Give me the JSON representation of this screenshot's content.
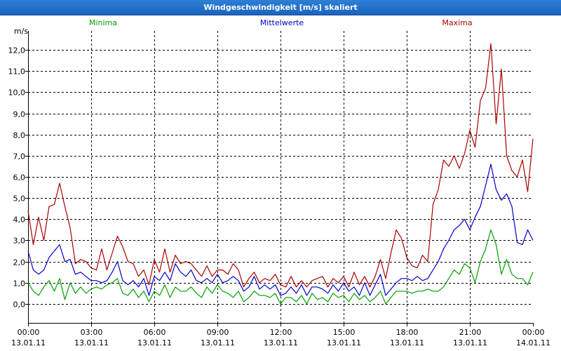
{
  "window": {
    "title": "Windgeschwindigkeit [m/s] skaliert"
  },
  "chart_data": {
    "type": "line",
    "title": "Windgeschwindigkeit [m/s] skaliert",
    "ylabel": "m/s",
    "ylim": [
      -0.9,
      12.9
    ],
    "yticks": [
      0,
      1,
      2,
      3,
      4,
      5,
      6,
      7,
      8,
      9,
      10,
      11,
      12
    ],
    "ytick_labels": [
      "0,0",
      "1,0",
      "2,0",
      "3,0",
      "4,0",
      "5,0",
      "6,0",
      "7,0",
      "8,0",
      "9,0",
      "10,0",
      "11,0",
      "12,0"
    ],
    "xlim": [
      0,
      24
    ],
    "xticks": [
      0,
      3,
      6,
      9,
      12,
      15,
      18,
      21,
      24
    ],
    "xtick_labels": [
      {
        "time": "00:00",
        "date": "13.01.11"
      },
      {
        "time": "03:00",
        "date": "13.01.11"
      },
      {
        "time": "06:00",
        "date": "13.01.11"
      },
      {
        "time": "09:00",
        "date": "13.01.11"
      },
      {
        "time": "12:00",
        "date": "13.01.11"
      },
      {
        "time": "15:00",
        "date": "13.01.11"
      },
      {
        "time": "18:00",
        "date": "13.01.11"
      },
      {
        "time": "21:00",
        "date": "13.01.11"
      },
      {
        "time": "00:00",
        "date": "14.01.11"
      }
    ],
    "grid": true,
    "legend_position": "top",
    "series": [
      {
        "name": "Minima",
        "color": "#00a000",
        "x": [
          0,
          0.25,
          0.5,
          0.75,
          1.0,
          1.25,
          1.5,
          1.75,
          2.0,
          2.25,
          2.5,
          2.75,
          3.0,
          3.25,
          3.5,
          3.75,
          4.0,
          4.25,
          4.5,
          4.75,
          5.0,
          5.25,
          5.5,
          5.75,
          6.0,
          6.25,
          6.5,
          6.75,
          7.0,
          7.25,
          7.5,
          7.75,
          8.0,
          8.25,
          8.5,
          8.75,
          9.0,
          9.25,
          9.5,
          9.75,
          10.0,
          10.25,
          10.5,
          10.75,
          11.0,
          11.25,
          11.5,
          11.75,
          12.0,
          12.25,
          12.5,
          12.75,
          13.0,
          13.25,
          13.5,
          13.75,
          14.0,
          14.25,
          14.5,
          14.75,
          15.0,
          15.25,
          15.5,
          15.75,
          16.0,
          16.25,
          16.5,
          16.75,
          17.0,
          17.25,
          17.5,
          17.75,
          18.0,
          18.25,
          18.5,
          18.75,
          19.0,
          19.25,
          19.5,
          19.75,
          20.0,
          20.25,
          20.5,
          20.75,
          21.0,
          21.25,
          21.5,
          21.75,
          22.0,
          22.25,
          22.5,
          22.75,
          23.0,
          23.25,
          23.5,
          23.75,
          24.0
        ],
        "y": [
          1.0,
          0.6,
          0.4,
          0.8,
          1.1,
          0.6,
          1.2,
          0.2,
          1.0,
          0.5,
          0.8,
          0.5,
          0.7,
          0.8,
          0.7,
          0.9,
          1.0,
          1.2,
          0.5,
          0.4,
          0.7,
          0.3,
          0.6,
          0.1,
          0.6,
          0.4,
          0.9,
          0.3,
          0.8,
          0.6,
          0.6,
          0.8,
          0.5,
          0.3,
          0.8,
          0.5,
          0.9,
          0.6,
          0.5,
          0.3,
          0.6,
          0.1,
          0.3,
          0.6,
          0.4,
          0.4,
          0.3,
          0.5,
          0.0,
          0.3,
          0.3,
          0.1,
          0.4,
          0.0,
          0.5,
          0.2,
          0.3,
          0.1,
          0.5,
          0.3,
          0.4,
          0.1,
          0.5,
          0.2,
          0.4,
          0.1,
          0.3,
          0.6,
          0.0,
          0.3,
          0.6,
          0.6,
          0.6,
          0.5,
          0.6,
          0.6,
          0.7,
          0.6,
          0.6,
          0.8,
          1.2,
          1.6,
          1.4,
          1.9,
          1.7,
          1.0,
          2.0,
          2.6,
          3.5,
          2.8,
          1.4,
          2.1,
          1.4,
          1.2,
          1.2,
          0.9,
          1.5
        ]
      },
      {
        "name": "Mittelwerte",
        "color": "#0000cc",
        "x": [
          0,
          0.25,
          0.5,
          0.75,
          1.0,
          1.25,
          1.5,
          1.75,
          2.0,
          2.25,
          2.5,
          2.75,
          3.0,
          3.25,
          3.5,
          3.75,
          4.0,
          4.25,
          4.5,
          4.75,
          5.0,
          5.25,
          5.5,
          5.75,
          6.0,
          6.25,
          6.5,
          6.75,
          7.0,
          7.25,
          7.5,
          7.75,
          8.0,
          8.25,
          8.5,
          8.75,
          9.0,
          9.25,
          9.5,
          9.75,
          10.0,
          10.25,
          10.5,
          10.75,
          11.0,
          11.25,
          11.5,
          11.75,
          12.0,
          12.25,
          12.5,
          12.75,
          13.0,
          13.25,
          13.5,
          13.75,
          14.0,
          14.25,
          14.5,
          14.75,
          15.0,
          15.25,
          15.5,
          15.75,
          16.0,
          16.25,
          16.5,
          16.75,
          17.0,
          17.25,
          17.5,
          17.75,
          18.0,
          18.25,
          18.5,
          18.75,
          19.0,
          19.25,
          19.5,
          19.75,
          20.0,
          20.25,
          20.5,
          20.75,
          21.0,
          21.25,
          21.5,
          21.75,
          22.0,
          22.25,
          22.5,
          22.75,
          23.0,
          23.25,
          23.5,
          23.75,
          24.0
        ],
        "y": [
          2.5,
          1.6,
          1.4,
          1.6,
          2.2,
          2.5,
          2.8,
          2.0,
          2.1,
          1.4,
          1.5,
          1.3,
          1.1,
          1.1,
          1.0,
          1.1,
          1.5,
          2.0,
          1.1,
          0.9,
          1.1,
          0.8,
          1.2,
          0.4,
          1.3,
          1.1,
          1.5,
          1.1,
          1.9,
          1.5,
          1.3,
          1.6,
          1.1,
          1.0,
          1.2,
          1.0,
          1.4,
          1.0,
          1.1,
          1.3,
          1.1,
          0.6,
          0.8,
          1.3,
          0.7,
          0.9,
          0.7,
          0.9,
          0.4,
          0.5,
          0.8,
          0.5,
          0.9,
          0.4,
          0.8,
          0.8,
          0.7,
          0.5,
          0.9,
          0.6,
          1.0,
          0.6,
          0.8,
          0.4,
          1.0,
          0.4,
          0.9,
          1.4,
          0.4,
          0.7,
          1.0,
          1.2,
          1.2,
          1.1,
          1.3,
          1.1,
          1.2,
          1.6,
          2.0,
          2.6,
          3.0,
          3.5,
          3.7,
          4.0,
          3.5,
          4.1,
          4.6,
          5.6,
          6.6,
          5.4,
          4.9,
          5.2,
          4.6,
          2.9,
          2.8,
          3.5,
          3.0
        ]
      },
      {
        "name": "Maxima",
        "color": "#aa0000",
        "x": [
          0,
          0.25,
          0.5,
          0.75,
          1.0,
          1.25,
          1.5,
          1.75,
          2.0,
          2.25,
          2.5,
          2.75,
          3.0,
          3.25,
          3.5,
          3.75,
          4.0,
          4.25,
          4.5,
          4.75,
          5.0,
          5.25,
          5.5,
          5.75,
          6.0,
          6.25,
          6.5,
          6.75,
          7.0,
          7.25,
          7.5,
          7.75,
          8.0,
          8.25,
          8.5,
          8.75,
          9.0,
          9.25,
          9.5,
          9.75,
          10.0,
          10.25,
          10.5,
          10.75,
          11.0,
          11.25,
          11.5,
          11.75,
          12.0,
          12.25,
          12.5,
          12.75,
          13.0,
          13.25,
          13.5,
          13.75,
          14.0,
          14.25,
          14.5,
          14.75,
          15.0,
          15.25,
          15.5,
          15.75,
          16.0,
          16.25,
          16.5,
          16.75,
          17.0,
          17.25,
          17.5,
          17.75,
          18.0,
          18.25,
          18.5,
          18.75,
          19.0,
          19.25,
          19.5,
          19.75,
          20.0,
          20.25,
          20.5,
          20.75,
          21.0,
          21.25,
          21.5,
          21.75,
          22.0,
          22.25,
          22.5,
          22.75,
          23.0,
          23.25,
          23.5,
          23.75,
          24.0
        ],
        "y": [
          4.4,
          2.8,
          4.1,
          3.0,
          4.6,
          4.7,
          5.7,
          4.6,
          3.6,
          1.9,
          2.1,
          2.0,
          1.7,
          1.6,
          2.6,
          1.6,
          2.4,
          3.2,
          2.7,
          2.0,
          1.9,
          1.3,
          1.6,
          0.9,
          2.1,
          1.5,
          2.6,
          1.5,
          2.3,
          1.9,
          2.0,
          1.9,
          1.6,
          1.3,
          1.8,
          1.3,
          1.6,
          1.6,
          1.4,
          1.9,
          1.6,
          0.8,
          1.2,
          1.5,
          1.0,
          1.2,
          1.1,
          1.4,
          0.9,
          0.8,
          1.3,
          0.8,
          1.1,
          0.8,
          1.1,
          1.2,
          1.3,
          0.8,
          1.2,
          1.0,
          1.3,
          0.8,
          1.5,
          0.9,
          1.3,
          0.8,
          1.3,
          2.1,
          1.2,
          2.4,
          3.5,
          3.1,
          2.2,
          1.8,
          1.7,
          2.3,
          2.0,
          4.7,
          5.4,
          6.8,
          6.5,
          7.0,
          6.4,
          7.1,
          8.2,
          7.4,
          9.6,
          10.2,
          12.3,
          8.5,
          11.1,
          7.0,
          6.3,
          6.0,
          6.8,
          5.3,
          7.8
        ]
      }
    ]
  }
}
